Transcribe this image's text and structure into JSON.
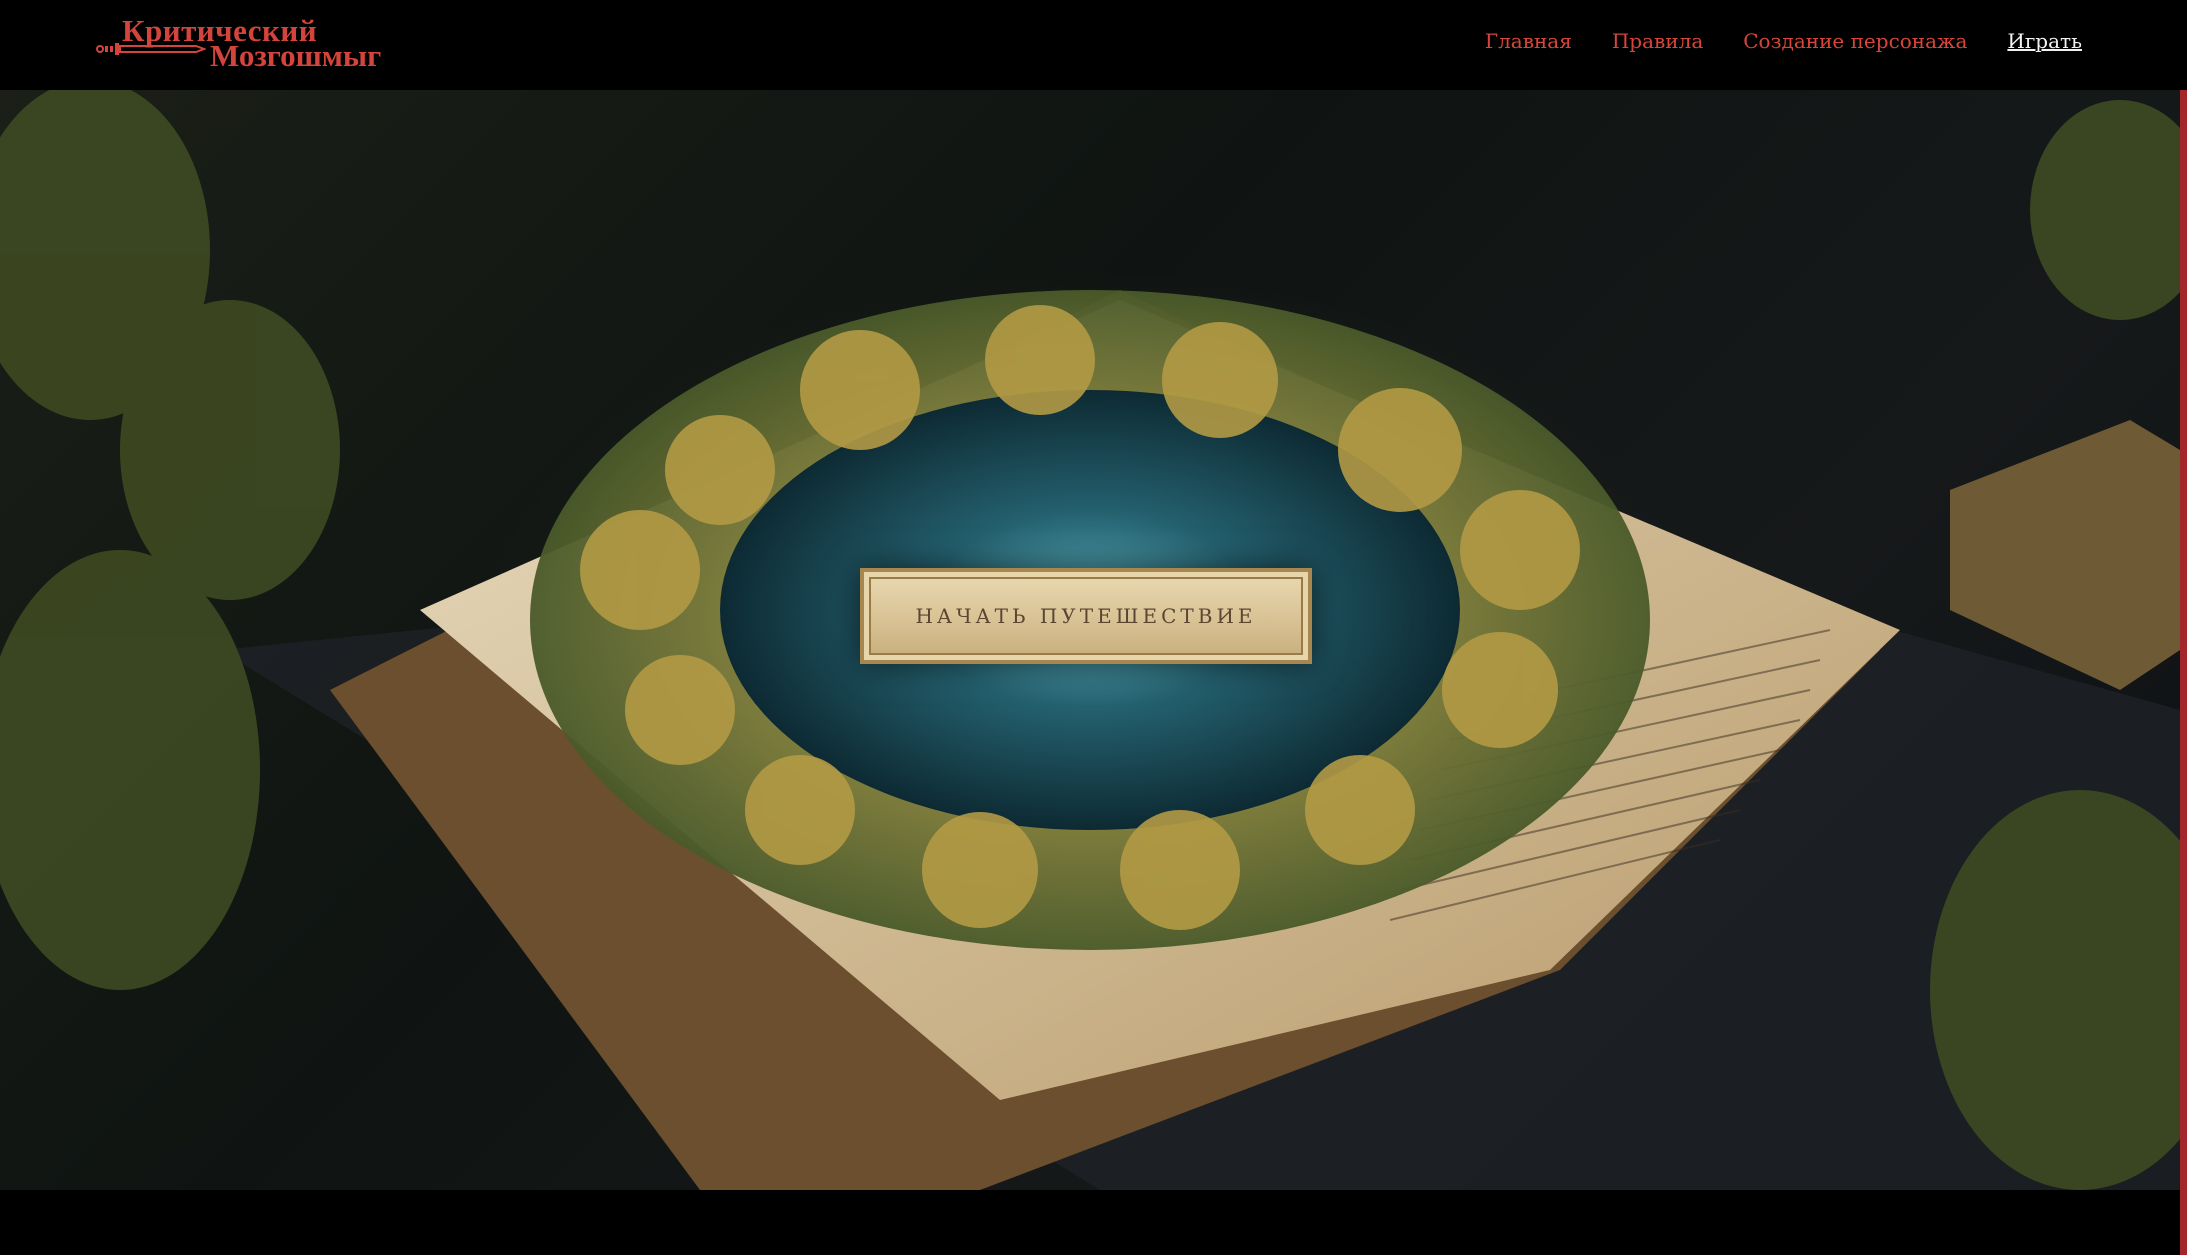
{
  "logo": {
    "line1": "Критический",
    "line2": "Мозгошмыг",
    "icon": "sword-icon",
    "color": "#d2443c"
  },
  "nav": {
    "items": [
      {
        "label": "Главная",
        "active": false
      },
      {
        "label": "Правила",
        "active": false
      },
      {
        "label": "Создание персонажа",
        "active": false
      },
      {
        "label": "Играть",
        "active": true
      }
    ],
    "color": "#d8453c",
    "active_color": "#f2f2f2"
  },
  "hero": {
    "image": "open-book-forest-portal-illustration",
    "cta_label": "НАЧАТЬ ПУТЕШЕСТВИЕ"
  }
}
